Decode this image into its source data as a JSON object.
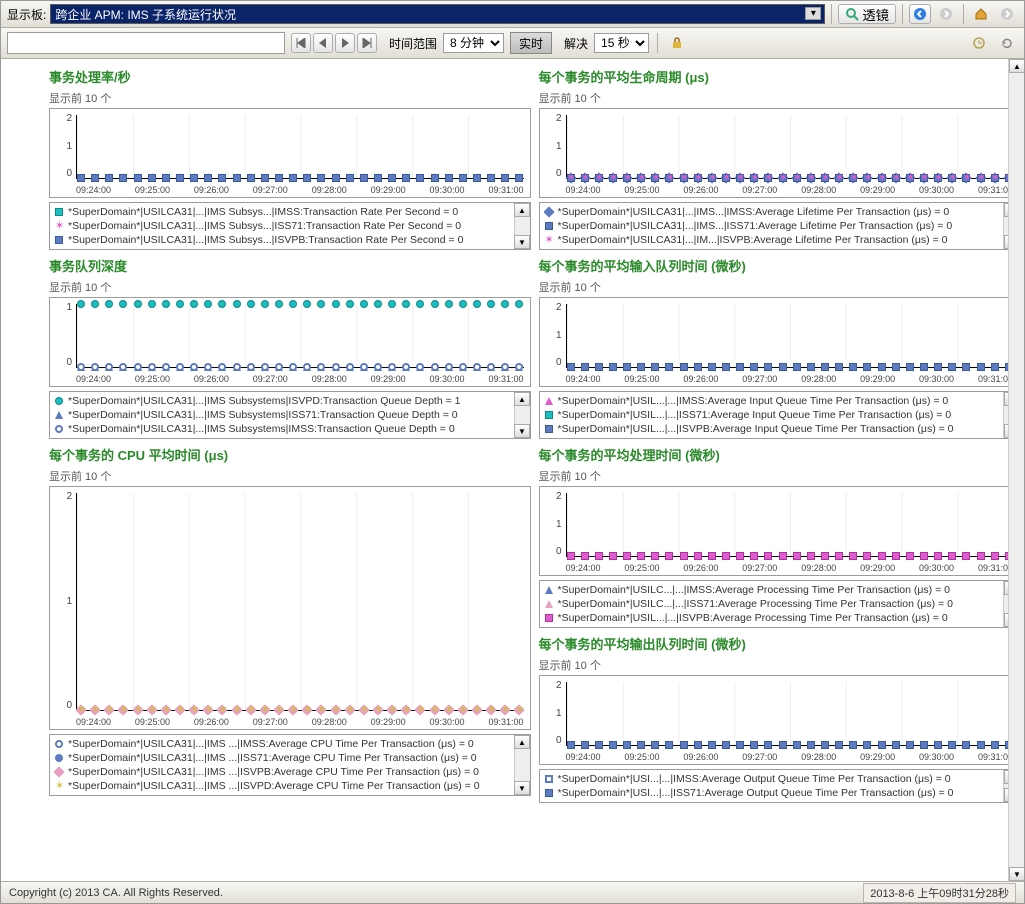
{
  "toolbar": {
    "board_label": "显示板:",
    "board_value": "跨企业 APM: IMS 子系统运行状况",
    "lens_label": "透镜",
    "time_range_label": "时间范围",
    "time_range_value": "8 分钟",
    "realtime_label": "实时",
    "resolve_label": "解决",
    "resolve_value": "15 秒"
  },
  "sub_prefix": "显示前 10 个",
  "xticks": [
    "09:24:00",
    "09:25:00",
    "09:26:00",
    "09:27:00",
    "09:28:00",
    "09:29:00",
    "09:30:00",
    "09:31:00"
  ],
  "chart_data": [
    {
      "id": "rate",
      "title": "事务处理率/秒",
      "type": "line",
      "xticks": "shared",
      "yticks": [
        0,
        1,
        2
      ],
      "series": [
        {
          "name": "IMSS",
          "marker": "m-sq-teal",
          "value": 0
        },
        {
          "name": "ISS71",
          "marker": "m-star-mag",
          "value": 0
        },
        {
          "name": "ISVPB",
          "marker": "m-sq-blue",
          "value": 0
        }
      ],
      "legend": [
        "*SuperDomain*|USILCA31|...|IMS Subsys...|IMSS:Transaction Rate Per Second = 0",
        "*SuperDomain*|USILCA31|...|IMS Subsys...|ISS71:Transaction Rate Per Second = 0",
        "*SuperDomain*|USILCA31|...|IMS Subsys...|ISVPB:Transaction Rate Per Second = 0"
      ]
    },
    {
      "id": "qdepth",
      "title": "事务队列深度",
      "type": "line",
      "xticks": "shared",
      "yticks": [
        0,
        1
      ],
      "series": [
        {
          "name": "ISVPD",
          "marker": "m-circ-teal",
          "value": 1
        },
        {
          "name": "ISS71",
          "marker": "m-tri-up-blue",
          "value": 0
        },
        {
          "name": "IMSS",
          "marker": "m-circ-blue-o",
          "value": 0
        }
      ],
      "legend": [
        "*SuperDomain*|USILCA31|...|IMS Subsystems|ISVPD:Transaction Queue Depth = 1",
        "*SuperDomain*|USILCA31|...|IMS Subsystems|ISS71:Transaction Queue Depth = 0",
        "*SuperDomain*|USILCA31|...|IMS Subsystems|IMSS:Transaction Queue Depth = 0"
      ]
    },
    {
      "id": "cpu",
      "title": "每个事务的 CPU 平均时间 (μs)",
      "type": "line",
      "xticks": "shared",
      "yticks": [
        0,
        1,
        2
      ],
      "tall": true,
      "series": [
        {
          "name": "IMSS",
          "marker": "m-circ-blue-o",
          "value": 0
        },
        {
          "name": "ISS71",
          "marker": "m-circ-blue",
          "value": 0
        },
        {
          "name": "ISVPB",
          "marker": "m-dia-pink",
          "value": 0
        },
        {
          "name": "ISVPD",
          "marker": "m-star-y",
          "value": 0
        }
      ],
      "legend": [
        "*SuperDomain*|USILCA31|...|IMS ...|IMSS:Average CPU Time Per Transaction (μs) = 0",
        "*SuperDomain*|USILCA31|...|IMS ...|ISS71:Average CPU Time Per Transaction (μs) = 0",
        "*SuperDomain*|USILCA31|...|IMS ...|ISVPB:Average CPU Time Per Transaction (μs) = 0",
        "*SuperDomain*|USILCA31|...|IMS ...|ISVPD:Average CPU Time Per Transaction (μs) = 0"
      ]
    },
    {
      "id": "life",
      "title": "每个事务的平均生命周期 (μs)",
      "type": "line",
      "xticks": "shared",
      "yticks": [
        0,
        1,
        2
      ],
      "series": [
        {
          "name": "IMSS",
          "marker": "m-dia-blue",
          "value": 0
        },
        {
          "name": "ISS71",
          "marker": "m-sq-blue",
          "value": 0
        },
        {
          "name": "ISVPB",
          "marker": "m-star-mag",
          "value": 0
        }
      ],
      "legend": [
        "*SuperDomain*|USILCA31|...|IMS...|IMSS:Average Lifetime Per Transaction (μs) = 0",
        "*SuperDomain*|USILCA31|...|IMS...|ISS71:Average Lifetime Per Transaction (μs) = 0",
        "*SuperDomain*|USILCA31|...|IM...|ISVPB:Average Lifetime Per Transaction (μs) = 0"
      ]
    },
    {
      "id": "inq",
      "title": "每个事务的平均输入队列时间 (微秒)",
      "type": "line",
      "xticks": "shared",
      "yticks": [
        0,
        1,
        2
      ],
      "series": [
        {
          "name": "IMSS",
          "marker": "m-tri-up-mag",
          "value": 0
        },
        {
          "name": "ISS71",
          "marker": "m-sq-teal",
          "value": 0
        },
        {
          "name": "ISVPB",
          "marker": "m-sq-blue",
          "value": 0
        }
      ],
      "legend": [
        "*SuperDomain*|USIL...|...|IMSS:Average Input Queue Time Per Transaction (μs) = 0",
        "*SuperDomain*|USIL...|...|ISS71:Average Input Queue Time Per Transaction (μs) = 0",
        "*SuperDomain*|USIL...|...|ISVPB:Average Input Queue Time Per Transaction (μs) = 0"
      ]
    },
    {
      "id": "proc",
      "title": "每个事务的平均处理时间 (微秒)",
      "type": "line",
      "xticks": "shared",
      "yticks": [
        0,
        1,
        2
      ],
      "series": [
        {
          "name": "IMSS",
          "marker": "m-tri-up-blue",
          "value": 0
        },
        {
          "name": "ISS71",
          "marker": "m-tri-up-pink",
          "value": 0
        },
        {
          "name": "ISVPB",
          "marker": "m-sq-mag",
          "value": 0
        }
      ],
      "legend": [
        "*SuperDomain*|USILC...|...|IMSS:Average Processing Time Per Transaction (μs) = 0",
        "*SuperDomain*|USILC...|...|ISS71:Average Processing Time Per Transaction (μs) = 0",
        "*SuperDomain*|USIL...|...|ISVPB:Average Processing Time Per Transaction (μs) = 0"
      ]
    },
    {
      "id": "outq",
      "title": "每个事务的平均输出队列时间 (微秒)",
      "type": "line",
      "xticks": "shared",
      "yticks": [
        0,
        1,
        2
      ],
      "series": [
        {
          "name": "IMSS",
          "marker": "m-sq-blue-o",
          "value": 0
        },
        {
          "name": "ISS71",
          "marker": "m-sq-blue",
          "value": 0
        }
      ],
      "legend": [
        "*SuperDomain*|USI...|...|IMSS:Average Output Queue Time Per Transaction (μs) = 0",
        "*SuperDomain*|USI...|...|ISS71:Average Output Queue Time Per Transaction (μs) = 0"
      ]
    }
  ],
  "status": {
    "left": "Copyright (c) 2013 CA. All Rights Reserved.",
    "right": "2013-8-6 上午09时31分28秒"
  }
}
